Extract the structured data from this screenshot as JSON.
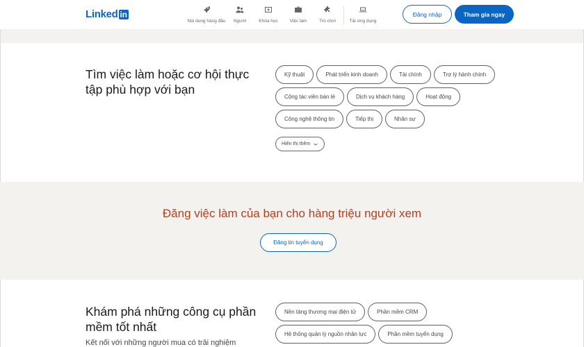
{
  "header": {
    "logo_text": "Linked",
    "logo_in": "in",
    "nav": [
      {
        "label": "Nội dung hàng đầu",
        "icon": "rocket-icon"
      },
      {
        "label": "Người",
        "icon": "people-icon"
      },
      {
        "label": "Khóa học",
        "icon": "video-icon"
      },
      {
        "label": "Việc làm",
        "icon": "briefcase-icon"
      },
      {
        "label": "Trò chơi",
        "icon": "puzzle-icon"
      },
      {
        "label": "Tải ứng dụng",
        "icon": "laptop-icon"
      }
    ],
    "login_label": "Đăng nhập",
    "join_label": "Tham gia ngay"
  },
  "jobs_section": {
    "title": "Tìm việc làm hoặc cơ hội thực tập phù hợp với bạn",
    "pills": [
      "Kỹ thuật",
      "Phát triển kinh doanh",
      "Tài chính",
      "Trợ lý hành chính",
      "Cộng tác viên bán lẻ",
      "Dịch vụ khách hàng",
      "Hoạt động",
      "Công nghệ thông tin",
      "Tiếp thị",
      "Nhân sự"
    ],
    "show_more_label": "Hiển thị thêm"
  },
  "post_band": {
    "title": "Đăng việc làm của bạn cho hàng triệu người xem",
    "button_label": "Đăng tin tuyển dụng"
  },
  "tools_section": {
    "title": "Khám phá những công cụ phần mềm tốt nhất",
    "pills": [
      "Nền tảng thương mại điện tử",
      "Phần mềm CRM",
      "Hệ thống quản lý nguồn nhân lực",
      "Phần mềm tuyển dụng"
    ],
    "subtext": "Kết nối với những người mua có trải nghiệm"
  },
  "colors": {
    "brand": "#0a66c2",
    "band_title": "#b24020",
    "band_bg": "#f3f2ef"
  }
}
